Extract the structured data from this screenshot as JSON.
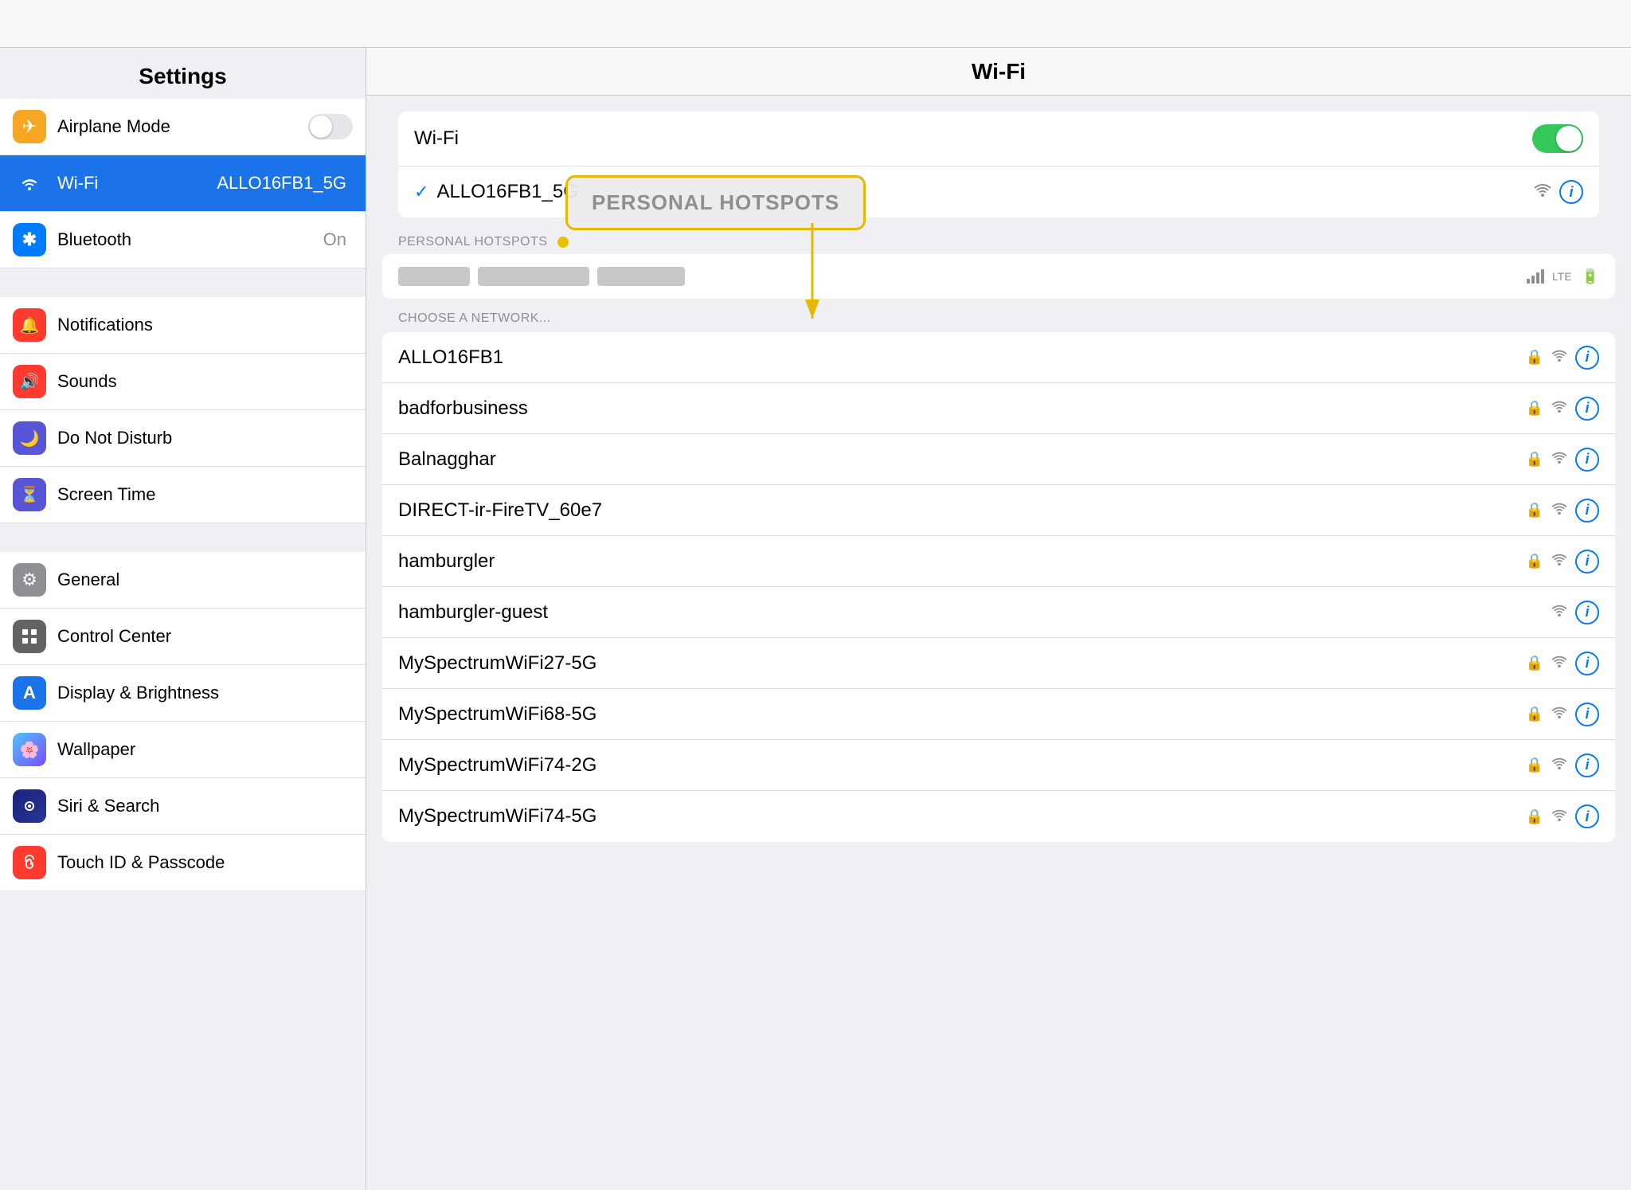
{
  "app": {
    "title": "Settings"
  },
  "sidebar": {
    "title": "Settings",
    "items": [
      {
        "id": "airplane-mode",
        "label": "Airplane Mode",
        "icon": "✈",
        "iconClass": "icon-orange",
        "value": "",
        "hasToggle": true,
        "toggleOn": false
      },
      {
        "id": "wifi",
        "label": "Wi-Fi",
        "icon": "📶",
        "iconClass": "icon-blue2",
        "value": "ALLO16FB1_5G",
        "hasToggle": false,
        "active": true
      },
      {
        "id": "bluetooth",
        "label": "Bluetooth",
        "icon": "✱",
        "iconClass": "icon-blue2",
        "value": "On",
        "hasToggle": false
      }
    ],
    "section2": [
      {
        "id": "notifications",
        "label": "Notifications",
        "icon": "🔔",
        "iconClass": "icon-red2"
      },
      {
        "id": "sounds",
        "label": "Sounds",
        "icon": "🔊",
        "iconClass": "icon-red2"
      },
      {
        "id": "do-not-disturb",
        "label": "Do Not Disturb",
        "icon": "🌙",
        "iconClass": "icon-purple"
      },
      {
        "id": "screen-time",
        "label": "Screen Time",
        "icon": "⏳",
        "iconClass": "indigo"
      }
    ],
    "section3": [
      {
        "id": "general",
        "label": "General",
        "icon": "⚙",
        "iconClass": "icon-gray"
      },
      {
        "id": "control-center",
        "label": "Control Center",
        "icon": "⊞",
        "iconClass": "icon-darkgray"
      },
      {
        "id": "display-brightness",
        "label": "Display & Brightness",
        "icon": "A",
        "iconClass": "icon-blue"
      },
      {
        "id": "wallpaper",
        "label": "Wallpaper",
        "icon": "🌸",
        "iconClass": "icon-wallpaper"
      },
      {
        "id": "siri-search",
        "label": "Siri & Search",
        "icon": "◎",
        "iconClass": "icon-siri"
      },
      {
        "id": "touch-id",
        "label": "Touch ID & Passcode",
        "icon": "◎",
        "iconClass": "icon-touchid"
      }
    ]
  },
  "wifi": {
    "title": "Wi-Fi",
    "wifi_label": "Wi-Fi",
    "wifi_toggle_on": true,
    "connected_network": "ALLO16FB1_5G",
    "personal_hotspots_label": "PERSONAL HOTSPOTS",
    "personal_hotspots_callout": "PERSONAL HOTSPOTS",
    "choose_network_label": "CHOOSE A NETWORK...",
    "networks": [
      {
        "name": "ALLO16FB1",
        "locked": true,
        "signal": "full"
      },
      {
        "name": "badforbusiness",
        "locked": true,
        "signal": "full"
      },
      {
        "name": "Balnagghar",
        "locked": true,
        "signal": "full"
      },
      {
        "name": "DIRECT-ir-FireTV_60e7",
        "locked": true,
        "signal": "full"
      },
      {
        "name": "hamburgler",
        "locked": true,
        "signal": "full"
      },
      {
        "name": "hamburgler-guest",
        "locked": false,
        "signal": "full"
      },
      {
        "name": "MySpectrumWiFi27-5G",
        "locked": true,
        "signal": "full"
      },
      {
        "name": "MySpectrumWiFi68-5G",
        "locked": true,
        "signal": "full"
      },
      {
        "name": "MySpectrumWiFi74-2G",
        "locked": true,
        "signal": "full"
      },
      {
        "name": "MySpectrumWiFi74-5G",
        "locked": true,
        "signal": "full"
      }
    ]
  }
}
